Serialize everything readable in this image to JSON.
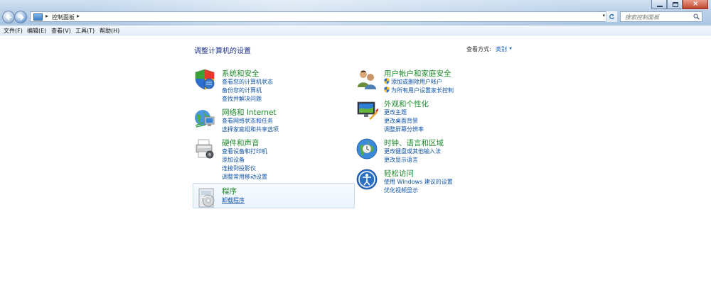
{
  "window": {
    "breadcrumb": "控制面板",
    "search_placeholder": "搜索控制面板"
  },
  "menu": [
    "文件(F)",
    "编辑(E)",
    "查看(V)",
    "工具(T)",
    "帮助(H)"
  ],
  "main": {
    "title": "调整计算机的设置",
    "view_by_label": "查看方式:",
    "view_by_value": "类别"
  },
  "categories": [
    {
      "title": "系统和安全",
      "icon": "system-security-icon",
      "links": [
        "查看您的计算机状态",
        "备份您的计算机",
        "查找并解决问题"
      ]
    },
    {
      "title": "网络和 Internet",
      "icon": "network-icon",
      "links": [
        "查看网络状态和任务",
        "选择家庭组和共享选项"
      ]
    },
    {
      "title": "硬件和声音",
      "icon": "hardware-sound-icon",
      "links": [
        "查看设备和打印机",
        "添加设备",
        "连接到投影仪",
        "调整常用移动设置"
      ]
    },
    {
      "title": "程序",
      "icon": "programs-icon",
      "links": [
        "卸载程序"
      ]
    },
    {
      "title": "用户帐户和家庭安全",
      "icon": "user-accounts-icon",
      "links": [
        "添加或删除用户帐户",
        "为所有用户设置家长控制"
      ]
    },
    {
      "title": "外观和个性化",
      "icon": "appearance-icon",
      "links": [
        "更改主题",
        "更改桌面背景",
        "调整屏幕分辨率"
      ]
    },
    {
      "title": "时钟、语言和区域",
      "icon": "clock-language-region-icon",
      "links": [
        "更改键盘或其他输入法",
        "更改显示语言"
      ]
    },
    {
      "title": "轻松访问",
      "icon": "ease-of-access-icon",
      "links": [
        "使用 Windows 建议的设置",
        "优化视频显示"
      ]
    }
  ],
  "colors": {
    "category_title": "#1e8a2c",
    "link": "#0f53a8",
    "page_title": "#1e3287"
  }
}
